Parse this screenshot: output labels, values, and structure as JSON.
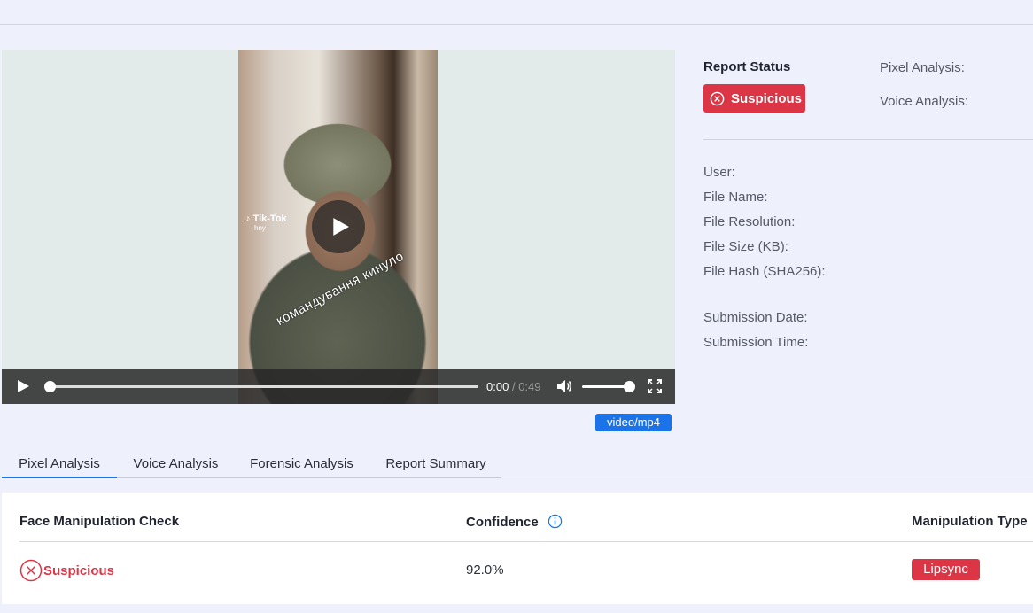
{
  "video": {
    "watermark_brand": "Tik-Tok",
    "watermark_user": "hny",
    "caption": "командування кинуло",
    "current_time": "0:00",
    "separator": "/",
    "duration": "0:49",
    "volume_level": 1.0,
    "progress_fraction": 0.0
  },
  "mime_type": "video/mp4",
  "report": {
    "title": "Report Status",
    "status": "Suspicious",
    "status_color": "#dc3545",
    "pixel_label": "Pixel Analysis:",
    "voice_label": "Voice Analysis:"
  },
  "meta": {
    "user": "User:",
    "file_name": "File Name:",
    "file_resolution": "File Resolution:",
    "file_size": "File Size (KB):",
    "file_hash": "File Hash (SHA256):",
    "submission_date": "Submission Date:",
    "submission_time": "Submission Time:"
  },
  "tabs": [
    {
      "label": "Pixel Analysis",
      "active": true
    },
    {
      "label": "Voice Analysis",
      "active": false
    },
    {
      "label": "Forensic Analysis",
      "active": false
    },
    {
      "label": "Report Summary",
      "active": false
    }
  ],
  "table": {
    "headers": {
      "check": "Face Manipulation Check",
      "confidence": "Confidence",
      "type": "Manipulation Type"
    },
    "row": {
      "status": "Suspicious",
      "confidence": "92.0%",
      "type": "Lipsync"
    }
  },
  "colors": {
    "accent": "#1a73e8",
    "danger": "#dc3545",
    "background": "#eef0fb"
  }
}
